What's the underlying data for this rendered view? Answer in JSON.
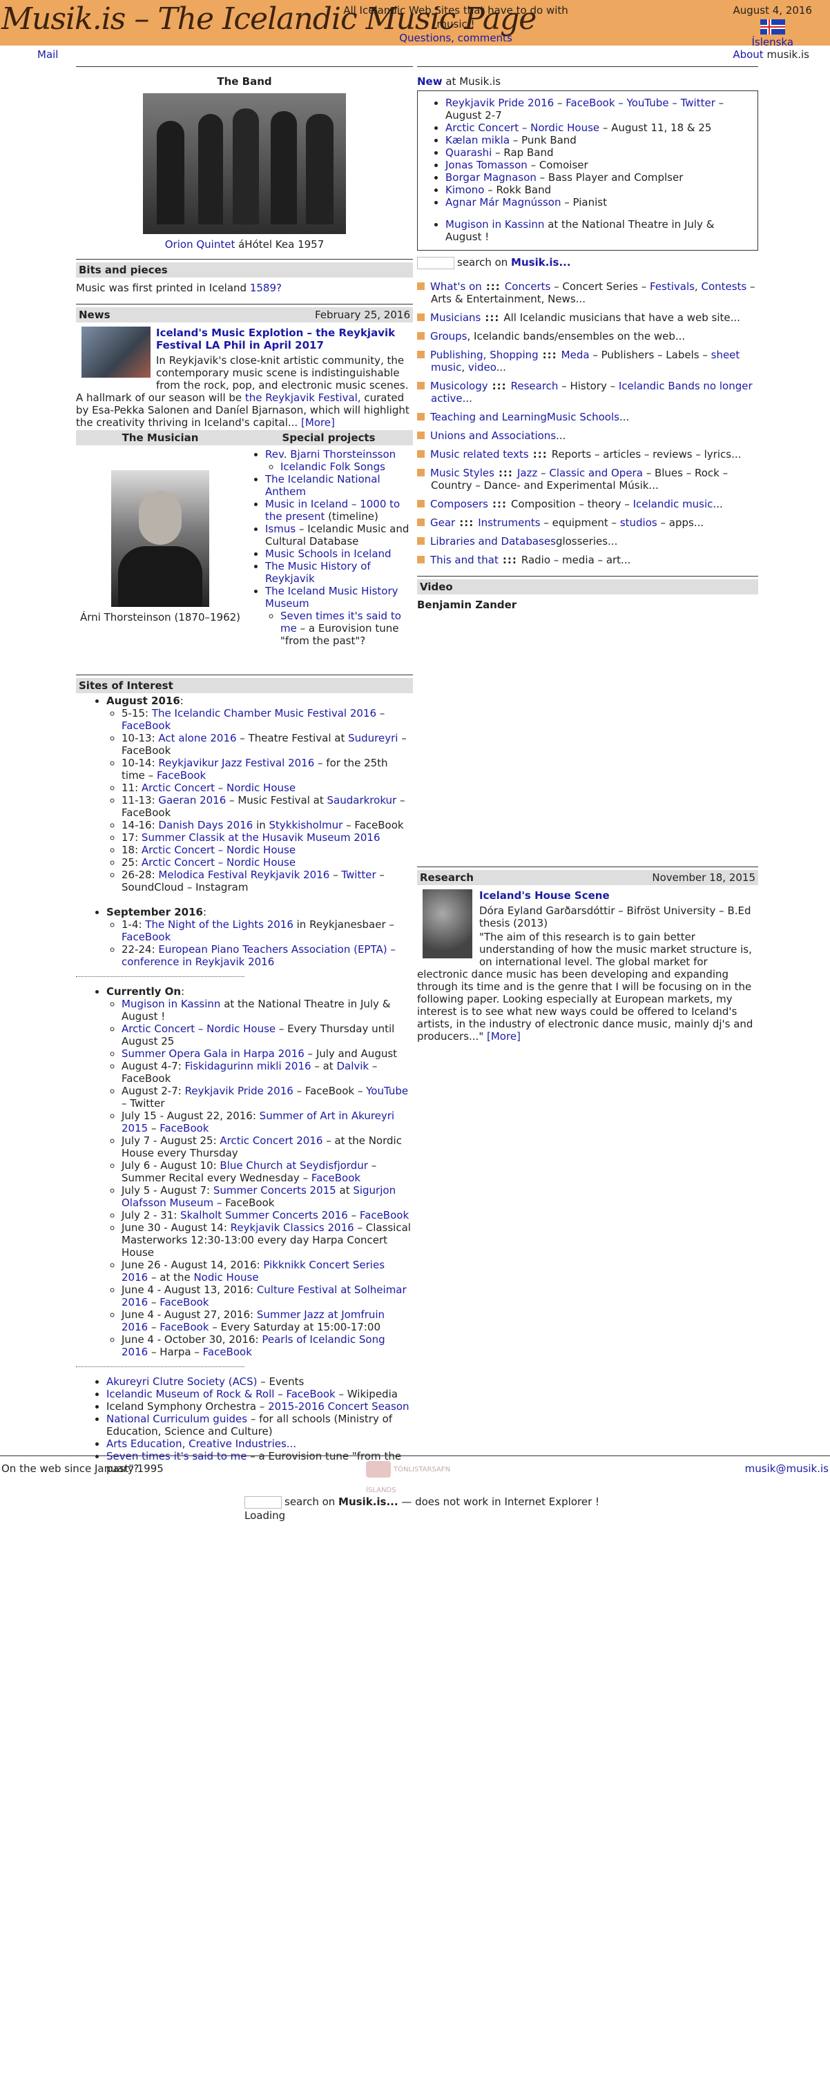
{
  "header": {
    "logo": "Musik.is – The Icelandic Music Page",
    "tagline": "All Icelandic Web Sites that have to do with music !",
    "questions": "Questions, comments",
    "date": "August 4, 2016",
    "lang": "Íslenska",
    "brand_color": "#eea75e"
  },
  "subbar": {
    "mail": "Mail",
    "about": "About",
    "site": "musik.is"
  },
  "band": {
    "title": "The Band",
    "caption_link": "Orion Quintet",
    "caption_rest": " áHótel Kea 1957"
  },
  "bits": {
    "title": "Bits and pieces",
    "text": "Music was first printed in Iceland ",
    "year": "1589?"
  },
  "news": {
    "title": "News",
    "date": "February 25, 2016",
    "headline": "Iceland's Music Explotion – the Reykjavik Festival LA Phil in April 2017",
    "body1": "In Reykjavik's close-knit artistic community, the contemporary music scene is indistinguishable from the rock, pop, and electronic music scenes. A hallmark of our season will be ",
    "body_link": "the Reykjavik Festival",
    "body2": ", curated by Esa-Pekka Salonen and Daníel Bjarnason, which will highlight the creativity thriving in Iceland's capital...",
    "more": "[More]"
  },
  "musician": {
    "title": "The Musician",
    "caption": "Árni Thorsteinson (1870–1962)"
  },
  "special": {
    "title": "Special projects",
    "items": [
      {
        "link": "Rev. Bjarni Thorsteinsson",
        "rest": ""
      },
      {
        "link": "The Icelandic National Anthem",
        "rest": ""
      },
      {
        "link": "Music in Iceland – 1000 to the present",
        "rest": " (timeline)"
      },
      {
        "link": "Ismus",
        "rest": " – Icelandic Music and Cultural Database"
      },
      {
        "link": "Music Schools in Iceland",
        "rest": ""
      },
      {
        "link": "The Music History of Reykjavik",
        "rest": ""
      },
      {
        "link": "The Iceland Music History Museum",
        "rest": ""
      }
    ],
    "sub1": "Icelandic Folk Songs",
    "sub2_link": "Seven times it's said to me",
    "sub2_rest": " – a Eurovision tune \"from the past\"?"
  },
  "sites": {
    "title": "Sites of Interest",
    "aug_title": "August 2016",
    "aug": [
      [
        "5-15: ",
        "The Icelandic Chamber Music Festival 2016",
        " – ",
        "FaceBook",
        ""
      ],
      [
        "10-13: ",
        "Act alone 2016",
        " – Theatre Festival at ",
        "Sudureyri",
        " – FaceBook"
      ],
      [
        "10-14: ",
        "Reykjavikur Jazz Festival 2016",
        " – for the 25th time – ",
        "FaceBook",
        ""
      ],
      [
        "11: ",
        "Arctic Concert – Nordic House",
        "",
        "",
        ""
      ],
      [
        "11-13: ",
        "Gaeran 2016",
        " – Music Festival at ",
        "Saudarkrokur",
        " – FaceBook"
      ],
      [
        "14-16: ",
        "Danish Days 2016",
        " in ",
        "Stykkisholmur",
        " – FaceBook"
      ],
      [
        "17: ",
        "Summer Classik at the Husavik Museum 2016",
        "",
        "",
        ""
      ],
      [
        "18: ",
        "Arctic Concert – Nordic House",
        "",
        "",
        ""
      ],
      [
        "25: ",
        "Arctic Concert – Nordic House",
        "",
        "",
        ""
      ],
      [
        "26-28: ",
        "Melodica Festival Reykjavik 2016",
        " – ",
        "Twitter",
        " – SoundCloud – Instagram"
      ]
    ],
    "sep_title": "September 2016",
    "sep": [
      [
        "1-4: ",
        "The Night of the Lights 2016",
        " in Reykjanesbaer – ",
        "FaceBook",
        ""
      ],
      [
        "22-24: ",
        "European Piano Teachers Association (EPTA) – conference in Reykjavik 2016",
        "",
        "",
        ""
      ]
    ],
    "cur_title": "Currently On",
    "cur": [
      [
        "",
        "Mugison in Kassinn",
        " at the National Theatre in July & August !",
        "",
        ""
      ],
      [
        "",
        "Arctic Concert – Nordic House",
        " – Every Thursday until August 25",
        "",
        ""
      ],
      [
        "",
        "Summer Opera Gala in Harpa 2016",
        " – July and August",
        "",
        ""
      ],
      [
        "August 4-7: ",
        "Fiskidagurinn mikli 2016",
        " – at ",
        "Dalvik",
        " – FaceBook"
      ],
      [
        "August 2-7: ",
        "Reykjavik Pride 2016",
        " – FaceBook – ",
        "YouTube",
        " – Twitter"
      ],
      [
        "July 15 - August 22, 2016: ",
        "Summer of Art in Akureyri 2015",
        " – ",
        "FaceBook",
        ""
      ],
      [
        "July 7 - August 25: ",
        "Arctic Concert 2016",
        " – at the Nordic House every Thursday",
        "",
        ""
      ],
      [
        "July 6 - August 10: ",
        "Blue Church at Seydisfjordur",
        " – Summer Recital every Wednesday – ",
        "FaceBook",
        ""
      ],
      [
        "July 5 - August 7: ",
        "Summer Concerts 2015",
        " at ",
        "Sigurjon Olafsson Museum",
        " – FaceBook"
      ],
      [
        "July 2 - 31: ",
        "Skalholt Summer Concerts 2016",
        " – ",
        "FaceBook",
        ""
      ],
      [
        "June 30 - August 14: ",
        "Reykjavik Classics 2016",
        " – Classical Masterworks 12:30-13:00 every day Harpa Concert House",
        "",
        ""
      ],
      [
        "June 26 - August 14, 2016: ",
        "Pikknikk Concert Series 2016",
        " – at the ",
        "Nodic House",
        ""
      ],
      [
        "June 4 - August 13, 2016: ",
        "Culture Festival at Solheimar 2016",
        " – ",
        "FaceBook",
        ""
      ],
      [
        "June 4 - August 27, 2016: ",
        "Summer Jazz at Jomfruin 2016",
        " – ",
        "FaceBook",
        " – Every Saturday at 15:00-17:00"
      ],
      [
        "June 4 - October 30, 2016: ",
        "Pearls of Icelandic Song 2016",
        " – Harpa – ",
        "FaceBook",
        ""
      ]
    ],
    "misc": [
      [
        "",
        "Akureyri Clutre Society (ACS)",
        " – Events",
        "",
        ""
      ],
      [
        "",
        "Icelandic Museum of Rock & Roll",
        " – ",
        "FaceBook",
        " – Wikipedia"
      ],
      [
        "Iceland Symphony Orchestra – ",
        "2015-2016 Concert Season",
        "",
        "",
        ""
      ],
      [
        "",
        "National Curriculum guides",
        " – for all schools (Ministry of Education, Science and Culture)",
        "",
        ""
      ],
      [
        "",
        "Arts Education, Creative Industries...",
        "",
        "",
        ""
      ],
      [
        "",
        "Seven times it's said to me",
        " – a Eurovision tune \"from the past\"?",
        "",
        ""
      ]
    ]
  },
  "newbox": {
    "new": "New",
    "at": " at Musik.is",
    "items": [
      [
        "",
        "Reykjavik Pride 2016",
        " – ",
        "FaceBook – YouTube – Twitter",
        " – August 2-7"
      ],
      [
        "",
        "Arctic Concert – Nordic House",
        " – August 11, 18 & 25",
        "",
        ""
      ],
      [
        "",
        "Kælan mikla",
        " – Punk Band",
        "",
        ""
      ],
      [
        "",
        "Quarashi",
        " – Rap Band",
        "",
        ""
      ],
      [
        "",
        "Jonas Tomasson",
        " – Comoiser",
        "",
        ""
      ],
      [
        "",
        "Borgar Magnason",
        " – Bass Player and Complser",
        "",
        ""
      ],
      [
        "",
        "Kimono",
        " – Rokk Band",
        "",
        ""
      ],
      [
        "",
        "Agnar Már Magnússon",
        " – Pianist",
        "",
        ""
      ]
    ],
    "last_link": "Mugison in Kassinn",
    "last_rest": " at the National Theatre in July & August !"
  },
  "search": {
    "label": "search on ",
    "brand": "Musik.is..."
  },
  "cats": [
    [
      [
        "Concerts",
        "link"
      ],
      [
        " – Concert Series – ",
        "text"
      ],
      [
        "Festivals",
        "link"
      ],
      [
        ", ",
        "text"
      ],
      [
        "Contests",
        "link"
      ],
      [
        " – Arts & Entertainment, News...",
        "text"
      ]
    ],
    [
      [
        "All Icelandic musicians that have a web site...",
        "text"
      ]
    ],
    [
      [
        "Groups",
        "link"
      ],
      [
        ", Icelandic bands/ensembles on the web...",
        "text"
      ]
    ],
    [
      [
        "Meda",
        "link"
      ],
      [
        " – Publishers – Labels – ",
        "text"
      ],
      [
        "sheet music",
        "link"
      ],
      [
        ", ",
        "text"
      ],
      [
        "video",
        "link"
      ],
      [
        "...",
        "text"
      ]
    ],
    [
      [
        "Research",
        "link"
      ],
      [
        " – History – ",
        "text"
      ],
      [
        "Icelandic Bands no longer active",
        "link"
      ],
      [
        "...",
        "text"
      ]
    ],
    [
      [
        "Music Schools",
        "link"
      ],
      [
        "...",
        "text"
      ]
    ],
    [
      [
        "Unions and Associations",
        "link"
      ],
      [
        "...",
        "text"
      ]
    ],
    [
      [
        "Reports – articles – reviews – lyrics...",
        "text"
      ]
    ],
    [
      [
        "Jazz",
        "link"
      ],
      [
        " – ",
        "text"
      ],
      [
        "Classic and Opera",
        "link"
      ],
      [
        " – Blues – Rock – Country – Dance- and Experimental Músik...",
        "text"
      ]
    ],
    [
      [
        "Composition – theory – ",
        "text"
      ],
      [
        "Icelandic music",
        "link"
      ],
      [
        "...",
        "text"
      ]
    ],
    [
      [
        "Instruments",
        "link"
      ],
      [
        " – equipment – ",
        "text"
      ],
      [
        "studios",
        "link"
      ],
      [
        " – apps...",
        "text"
      ]
    ],
    [
      [
        "glosseries...",
        "text"
      ]
    ],
    [
      [
        "Radio – media – art...",
        "text"
      ]
    ]
  ],
  "cat_heads": [
    "What's on",
    "Musicians",
    "",
    "Publishing, Shopping",
    "Musicology",
    "Teaching and Learning",
    "",
    "Music related texts",
    "Music Styles",
    "Composers",
    "Gear",
    "Libraries and Databases",
    "This and that"
  ],
  "video": {
    "title": "Video",
    "name": "Benjamin Zander"
  },
  "research": {
    "title": "Research",
    "date": "November 18, 2015",
    "headline": "Iceland's House Scene",
    "author": "Dóra Eyland Garðarsdóttir – Bifröst University – B.Ed thesis (2013)",
    "quote": "\"The aim of this research is to gain better understanding of how the music market structure is, on international level. The global market for electronic dance music has been developing and expanding through its time and is the genre that I will be focusing on in the following paper. Looking especially at European markets, my interest is to see what new ways could be offered to Iceland's artists, in the industry of electronic dance music, mainly dj's and producers...\"",
    "more": "[More]"
  },
  "footer": {
    "since": "On the web since January 1995",
    "logo": "TÓNLISTARSAFN ÍSLANDS",
    "email": "musik@musik.is",
    "search_label": "search on ",
    "search_brand": "Musik.is...",
    "search_note": " — does not work in Internet Explorer !",
    "loading": "Loading"
  }
}
